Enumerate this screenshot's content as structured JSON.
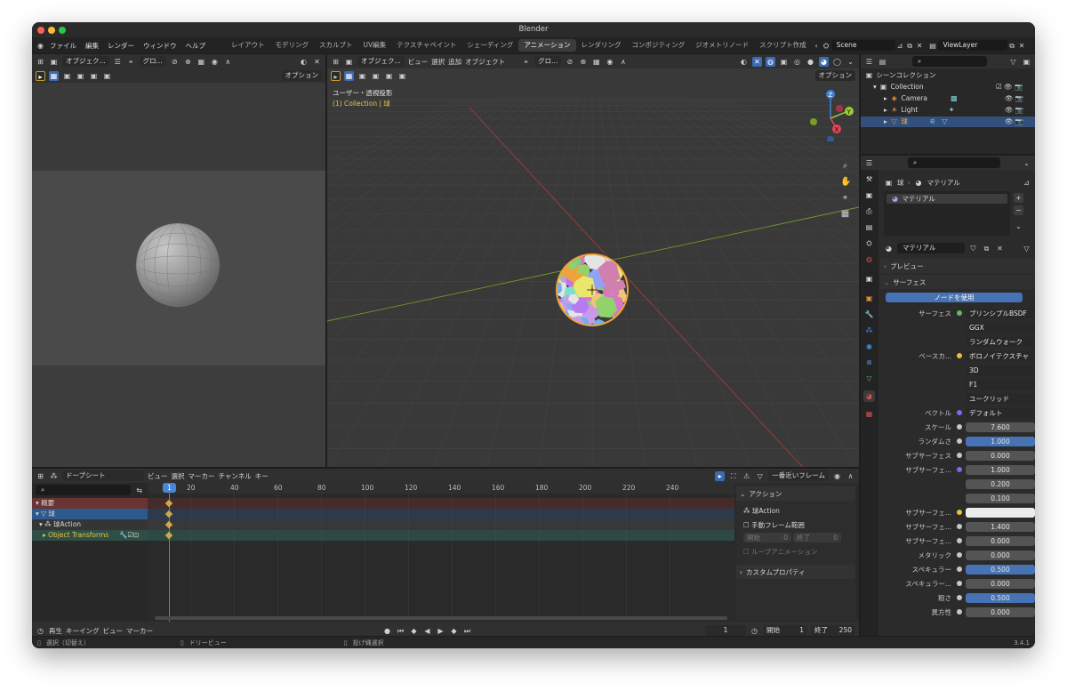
{
  "window": {
    "title": "Blender",
    "version": "3.4.1"
  },
  "menu": {
    "items": [
      "ファイル",
      "編集",
      "レンダー",
      "ウィンドウ",
      "ヘルプ"
    ],
    "workspaces": [
      "レイアウト",
      "モデリング",
      "スカルプト",
      "UV編集",
      "テクスチャペイント",
      "シェーディング",
      "アニメーション",
      "レンダリング",
      "コンポジティング",
      "ジオメトリノード",
      "スクリプト作成"
    ],
    "scene": "Scene",
    "view_layer": "ViewLayer"
  },
  "left_viewport": {
    "mode": "オブジェク...",
    "orientation": "グロ...",
    "options": "オプション"
  },
  "main_viewport": {
    "mode": "オブジェク...",
    "menus": [
      "ビュー",
      "選択",
      "追加",
      "オブジェクト"
    ],
    "orientation": "グロ...",
    "options": "オプション",
    "view_name": "ユーザー・透視投影",
    "collection_info": "(1) Collection | 球"
  },
  "outliner": {
    "root": "シーンコレクション",
    "collection": "Collection",
    "objects": [
      "Camera",
      "Light",
      "球"
    ]
  },
  "properties": {
    "breadcrumb_object": "球",
    "breadcrumb_material": "マテリアル",
    "slot_material": "マテリアル",
    "material_name": "マテリアル",
    "preview": "プレビュー",
    "surface_section": "サーフェス",
    "use_nodes": "ノードを使用",
    "rows": [
      {
        "label": "サーフェス",
        "value": "プリンシプルBSDF",
        "style": "dark",
        "dot": "#5bbf5b"
      },
      {
        "label": "",
        "value": "GGX",
        "style": "dark"
      },
      {
        "label": "",
        "value": "ランダムウォーク",
        "style": "dark"
      },
      {
        "label": "ベースカ...",
        "value": "ボロノイテクスチャ",
        "style": "dark",
        "dot": "#e3c33a"
      },
      {
        "label": "",
        "value": "3D",
        "style": "dark"
      },
      {
        "label": "",
        "value": "F1",
        "style": "dark"
      },
      {
        "label": "",
        "value": "ユークリッド",
        "style": "dark"
      },
      {
        "label": "ベクトル",
        "value": "デフォルト",
        "style": "dark",
        "dot": "#7b6ae6"
      },
      {
        "label": "スケール",
        "value": "7.600",
        "style": "gray"
      },
      {
        "label": "ランダムさ",
        "value": "1.000",
        "style": "blue"
      },
      {
        "label": "サブサーフェス",
        "value": "0.000",
        "style": "gray"
      },
      {
        "label": "サブサーフェ...",
        "value": "1.000",
        "style": "gray",
        "dot": "#7b6ae6"
      },
      {
        "label": "",
        "value": "0.200",
        "style": "gray"
      },
      {
        "label": "",
        "value": "0.100",
        "style": "gray"
      },
      {
        "label": "サブサーフェ...",
        "value": "",
        "style": "white",
        "dot": "#e3c33a"
      },
      {
        "label": "サブサーフェ...",
        "value": "1.400",
        "style": "gray"
      },
      {
        "label": "サブサーフェ...",
        "value": "0.000",
        "style": "gray"
      },
      {
        "label": "メタリック",
        "value": "0.000",
        "style": "gray"
      },
      {
        "label": "スペキュラー",
        "value": "0.500",
        "style": "blue"
      },
      {
        "label": "スペキュラー...",
        "value": "0.000",
        "style": "gray"
      },
      {
        "label": "粗さ",
        "value": "0.500",
        "style": "blue"
      },
      {
        "label": "異方性",
        "value": "0.000",
        "style": "gray"
      }
    ]
  },
  "dopesheet": {
    "mode": "ドープシート",
    "menus": [
      "ビュー",
      "選択",
      "マーカー",
      "チャンネル",
      "キー"
    ],
    "snap": "一番近いフレーム",
    "ticks": [
      "1",
      "20",
      "40",
      "60",
      "80",
      "100",
      "120",
      "140",
      "160",
      "180",
      "200",
      "220",
      "240"
    ],
    "channels": [
      "概要",
      "球",
      "球Action",
      "Object Transforms"
    ],
    "action_panel": {
      "title": "アクション",
      "action_name": "球Action",
      "manual_range": "手動フレーム範囲",
      "start_label": "開始",
      "start_value": "0",
      "end_label": "終了",
      "end_value": "0",
      "loop": "ループアニメーション",
      "custom_props": "カスタムプロパティ"
    }
  },
  "timeline": {
    "menus": [
      "再生",
      "キーイング",
      "ビュー",
      "マーカー"
    ],
    "current_frame": "1",
    "start_label": "開始",
    "start": "1",
    "end_label": "終了",
    "end": "250"
  },
  "status": {
    "select": "選択（切替え）",
    "dolly": "ドリービュー",
    "lasso": "投げ縄選択"
  }
}
